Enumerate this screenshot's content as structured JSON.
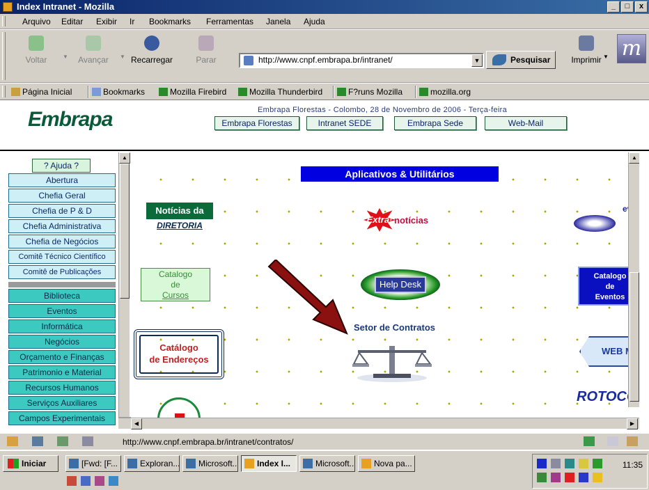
{
  "window": {
    "title": "Index Intranet - Mozilla",
    "buttons": [
      "_",
      "□",
      "x"
    ]
  },
  "menu": [
    "Arquivo",
    "Editar",
    "Exibir",
    "Ir",
    "Bookmarks",
    "Ferramentas",
    "Janela",
    "Ajuda"
  ],
  "toolbar": {
    "back": "Voltar",
    "forward": "Avançar",
    "reload": "Recarregar",
    "stop": "Parar",
    "url": "http://www.cnpf.embrapa.br/intranet/",
    "search": "Pesquisar",
    "print": "Imprimir"
  },
  "personal_toolbar": [
    "Página Inicial",
    "Bookmarks",
    "Mozilla Firebird",
    "Mozilla Thunderbird",
    "F?runs Mozilla",
    "mozilla.org"
  ],
  "page": {
    "logo": "Embrapa",
    "dateline": "Embrapa Florestas - Colombo, 28 de Novembro de 2006 - Terça-feira",
    "nav": [
      "Embrapa Florestas",
      "Intranet SEDE",
      "Embrapa Sede",
      "Web-Mail"
    ],
    "sidebar_help": "? Ajuda ?",
    "sidebar_top": [
      "Abertura",
      "Chefia Geral",
      "Chefia de P & D",
      "Chefia Administrativa",
      "Chefia de Negócios",
      "Comitê Técnico Científico",
      "Comitê de Publicações"
    ],
    "sidebar_bottom": [
      "Biblioteca",
      "Eventos",
      "Informática",
      "Negócios",
      "Orçamento e Finanças",
      "Patrimonio e Material",
      "Recursos Humanos",
      "Serviços Auxiliares",
      "Campos Experimentais"
    ],
    "apps_banner": "Aplicativos & Utilitários",
    "noticias_top": "Notícias da",
    "noticias_bottom": "DIRETORIA",
    "extra_burst": "Extra!",
    "extra_word": "notícias",
    "catalogo_cursos": [
      "Catalogo",
      "de",
      "Cursos"
    ],
    "helpdesk": "Help Desk",
    "contratos": "Setor de Contratos",
    "enderecos": [
      "Catálogo",
      "de Endereços"
    ],
    "eventos_word": "even",
    "catalogo_eventos": [
      "Catalogo",
      "de",
      "Eventos"
    ],
    "webmail": "WEB MA",
    "protocolo": "ROTOCO"
  },
  "status": {
    "url": "http://www.cnpf.embrapa.br/intranet/contratos/"
  },
  "taskbar": {
    "start": "Iniciar",
    "tasks": [
      "[Fwd: [F...",
      "Exploran...",
      "Microsoft...",
      "Index I...",
      "Microsoft...",
      "Nova pa..."
    ],
    "clock": "11:35"
  },
  "colors": {
    "title_bar": "#0a246a",
    "banner": "#0000e0",
    "arrow": "#8b1010",
    "logo": "#0a5a3a"
  }
}
